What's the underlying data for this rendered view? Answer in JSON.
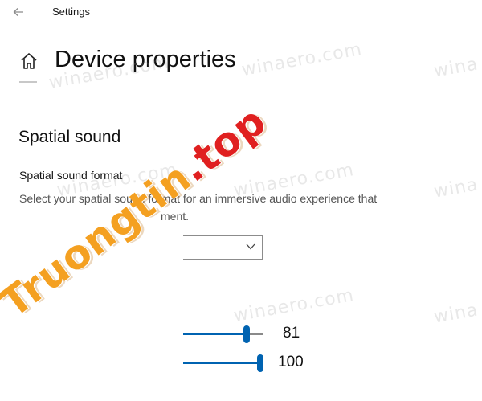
{
  "titlebar": {
    "app_title": "Settings",
    "back_icon": "back-arrow-icon"
  },
  "header": {
    "home_icon": "home-icon",
    "page_title": "Device properties"
  },
  "spatial_sound": {
    "section_title": "Spatial sound",
    "format_label": "Spatial sound format",
    "format_description_line1": "Select your spatial sound format for an immersive audio experience that",
    "format_description_line2": "ment.",
    "dropdown_value": "",
    "dropdown_icon": "chevron-down-icon"
  },
  "sliders": [
    {
      "value": 81,
      "label": "81"
    },
    {
      "value": 100,
      "label": "100"
    }
  ],
  "colors": {
    "accent": "#0063b1",
    "watermark_orange": "#f4a021",
    "watermark_red": "#e02020"
  },
  "watermarks": {
    "site": "winaero.com",
    "site_short": "wina",
    "brand_main": "Truongtin",
    "brand_dot": ".",
    "brand_tail": "top"
  }
}
